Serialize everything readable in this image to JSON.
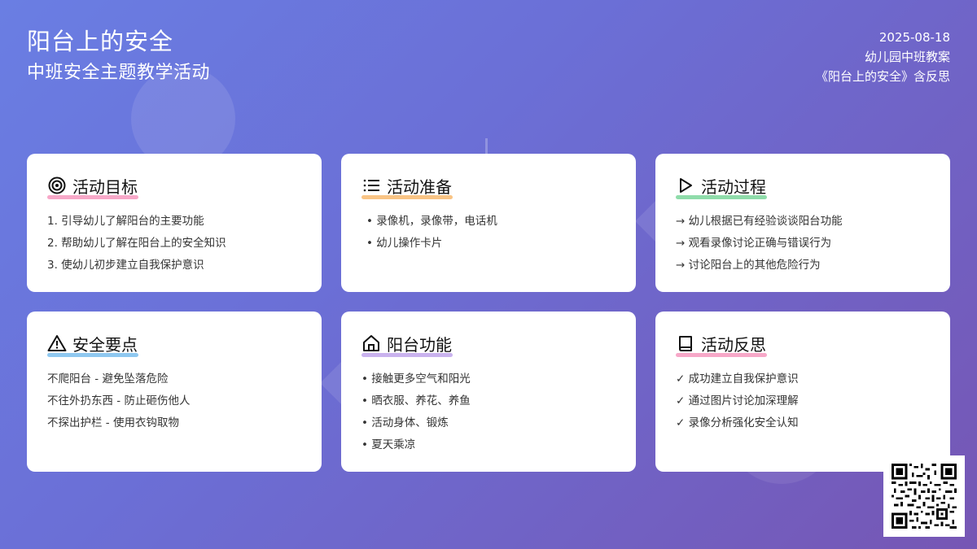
{
  "header": {
    "title": "阳台上的安全",
    "subtitle": "中班安全主题教学活动",
    "date": "2025-08-18",
    "line2": "幼儿园中班教案",
    "line3": "《阳台上的安全》含反思"
  },
  "colors": {
    "pink": "#f7a8c8",
    "orange": "#f9c485",
    "green": "#8fdcaa",
    "blue": "#8fc8f0",
    "purple": "#c9b2ee"
  },
  "cards": [
    {
      "title": "活动目标",
      "icon": "target-icon",
      "items": [
        "1. 引导幼儿了解阳台的主要功能",
        "2. 帮助幼儿了解在阳台上的安全知识",
        "3. 使幼儿初步建立自我保护意识"
      ]
    },
    {
      "title": "活动准备",
      "icon": "list-icon",
      "items": [
        "•  录像机，录像带，电话机",
        "•  幼儿操作卡片"
      ]
    },
    {
      "title": "活动过程",
      "icon": "play-icon",
      "items": [
        "→ 幼儿根据已有经验谈谈阳台功能",
        "→ 观看录像讨论正确与错误行为",
        "→ 讨论阳台上的其他危险行为"
      ]
    },
    {
      "title": "安全要点",
      "icon": "warning-icon",
      "items": [
        "不爬阳台 - 避免坠落危险",
        "不往外扔东西 - 防止砸伤他人",
        "不探出护栏 - 使用衣钩取物"
      ]
    },
    {
      "title": "阳台功能",
      "icon": "home-icon",
      "items": [
        "• 接触更多空气和阳光",
        "• 晒衣服、养花、养鱼",
        "• 活动身体、锻炼",
        "• 夏天乘凉"
      ]
    },
    {
      "title": "活动反思",
      "icon": "book-icon",
      "items": [
        "✓ 成功建立自我保护意识",
        "✓ 通过图片讨论加深理解",
        "✓ 录像分析强化安全认知"
      ]
    }
  ]
}
